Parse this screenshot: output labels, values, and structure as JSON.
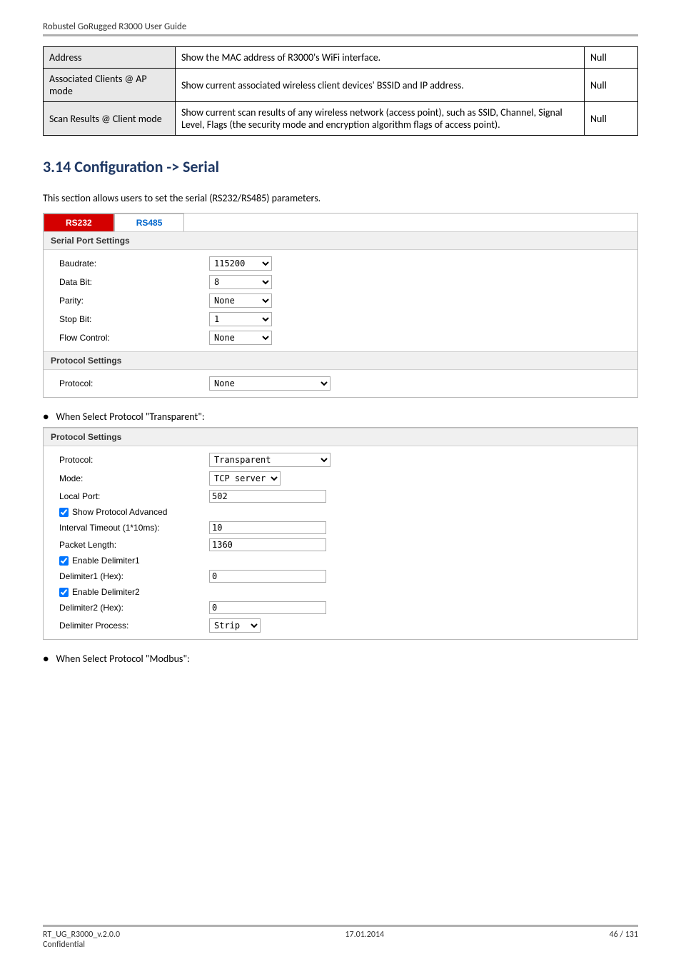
{
  "doc_header": "Robustel GoRugged R3000 User Guide",
  "summary_table": {
    "rows": [
      {
        "label": "Address",
        "desc": "Show the MAC address of R3000's WiFi interface.",
        "default": "Null"
      },
      {
        "label": "Associated Clients @ AP mode",
        "desc": "Show current associated wireless client devices' BSSID and IP address.",
        "default": "Null"
      },
      {
        "label": "Scan Results @ Client mode",
        "desc": "Show current scan results of any wireless network (access point), such as SSID, Channel, Signal Level, Flags (the security mode and encryption algorithm flags of access point).",
        "default": "Null"
      }
    ]
  },
  "section_heading": "3.14  Configuration -> Serial",
  "section_intro": "This section allows users to set the serial (RS232/RS485) parameters.",
  "serial": {
    "tabs": {
      "active": "RS232",
      "inactive": "RS485"
    },
    "port_heading": "Serial Port Settings",
    "protocol_heading": "Protocol Settings",
    "baudrate_label": "Baudrate:",
    "baudrate_value": "115200",
    "databit_label": "Data Bit:",
    "databit_value": "8",
    "parity_label": "Parity:",
    "parity_value": "None",
    "stopbit_label": "Stop Bit:",
    "stopbit_value": "1",
    "flow_label": "Flow Control:",
    "flow_value": "None",
    "protocol_label": "Protocol:",
    "protocol_value": "None"
  },
  "bullet_transparent": "When Select Protocol \"Transparent\":",
  "transparent": {
    "heading": "Protocol Settings",
    "protocol_label": "Protocol:",
    "protocol_value": "Transparent",
    "mode_label": "Mode:",
    "mode_value": "TCP server",
    "localport_label": "Local Port:",
    "localport_value": "502",
    "showadv_label": "Show Protocol Advanced",
    "interval_label": "Interval Timeout (1*10ms):",
    "interval_value": "10",
    "packet_label": "Packet Length:",
    "packet_value": "1360",
    "delim1_enable_label": "Enable Delimiter1",
    "delim1_label": "Delimiter1 (Hex):",
    "delim1_value": "0",
    "delim2_enable_label": "Enable Delimiter2",
    "delim2_label": "Delimiter2 (Hex):",
    "delim2_value": "0",
    "delimproc_label": "Delimiter Process:",
    "delimproc_value": "Strip"
  },
  "bullet_modbus": "When Select Protocol \"Modbus\":",
  "footer": {
    "left_line1": "RT_UG_R3000_v.2.0.0",
    "left_line2": "Confidential",
    "center": "17.01.2014",
    "right": "46 / 131"
  }
}
